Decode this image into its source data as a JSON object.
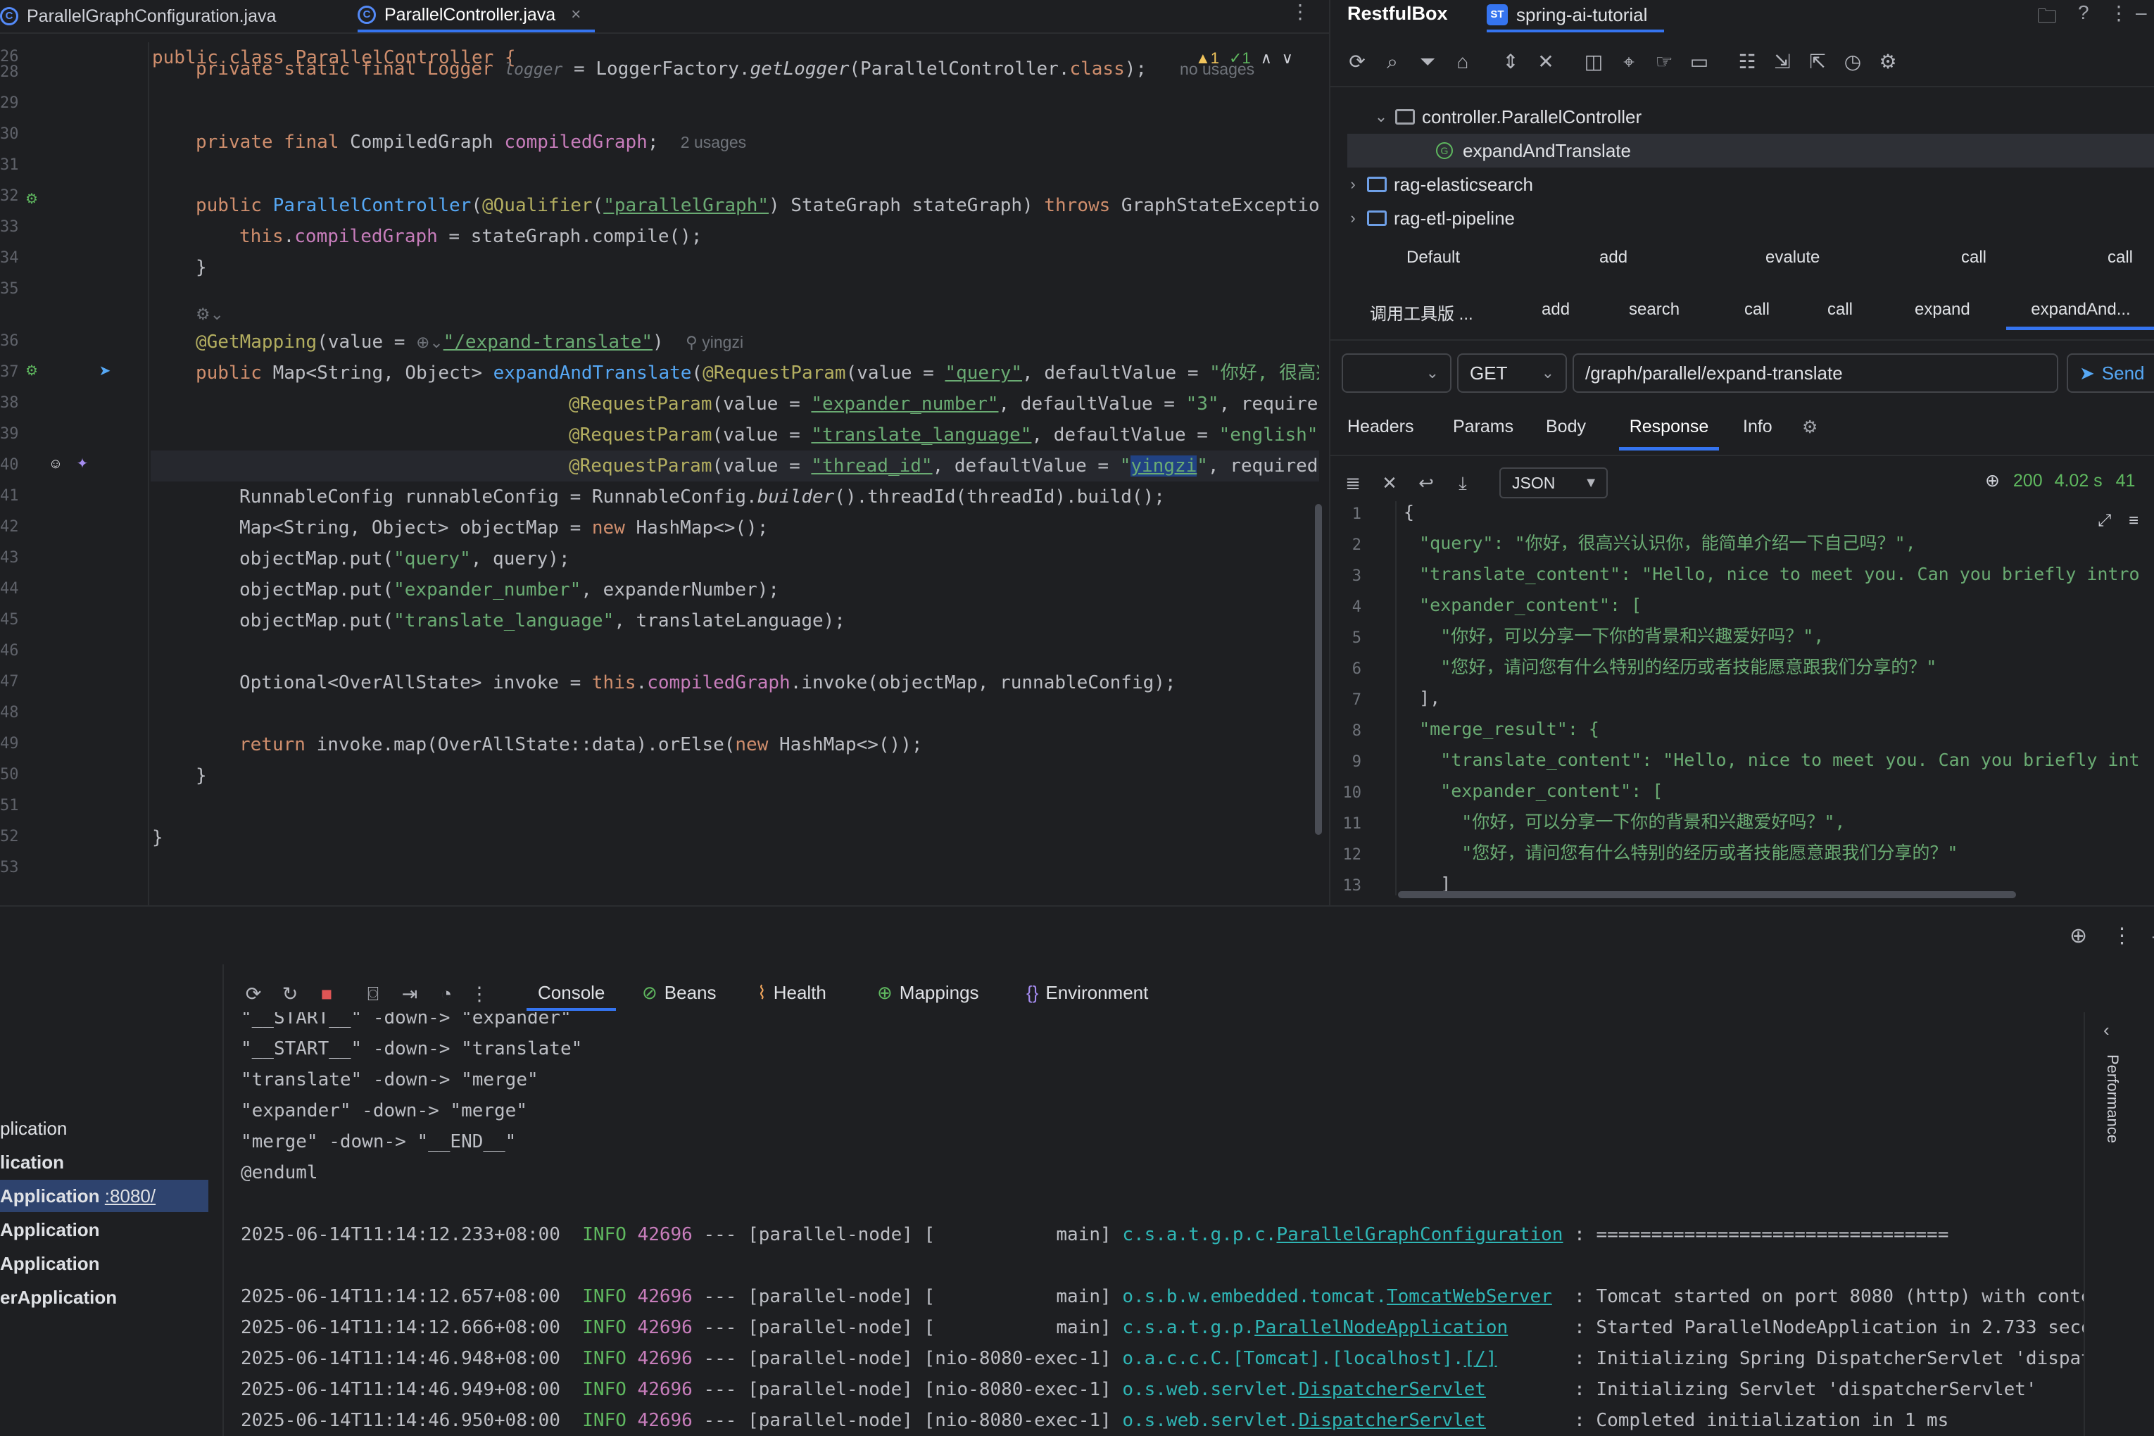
{
  "editor": {
    "tabs": [
      {
        "label": "ParallelGraphConfiguration.java",
        "active": false
      },
      {
        "label": "ParallelController.java",
        "active": true
      }
    ],
    "close_glyph": "×",
    "menu_glyph": "⋮",
    "inspection": {
      "warn": "▲1",
      "ok": "✓1",
      "up": "∧",
      "down": "∨"
    },
    "line_numbers": [
      "26",
      "28",
      "29",
      "30",
      "31",
      "32",
      "33",
      "34",
      "35",
      "36",
      "37",
      "38",
      "39",
      "40",
      "41",
      "42",
      "43",
      "44",
      "45",
      "46",
      "47",
      "48",
      "49",
      "50",
      "51",
      "52",
      "53"
    ],
    "code": {
      "l26": "public class ParallelController {",
      "l28_a": "private static final Logger ",
      "l28_b": "logger",
      "l28_c": " = LoggerFactory.",
      "l28_d": "getLogger",
      "l28_e": "(ParallelController.",
      "l28_f": "class",
      "l28_g": ");",
      "l28_usage": "no usages",
      "l30_a": "private final ",
      "l30_b": "CompiledGraph ",
      "l30_c": "compiledGraph",
      "l30_d": ";",
      "l30_usage": "2 usages",
      "l32_a": "public ",
      "l32_b": "ParallelController",
      "l32_c": "(",
      "l32_d": "@Qualifier",
      "l32_e": "(",
      "l32_f": "\"parallelGraph\"",
      "l32_g": ") StateGraph stateGraph) ",
      "l32_h": "throws",
      "l32_i": " GraphStateException",
      "l33_a": "this",
      "l33_b": ".",
      "l33_c": "compiledGraph",
      "l33_d": " = stateGraph.compile();",
      "l34": "}",
      "l36_hint": "⚙⌄",
      "l36_a": "@GetMapping",
      "l36_b": "(value = ",
      "l36_c": "⊕⌄",
      "l36_d": "\"/expand-translate\"",
      "l36_e": ")",
      "l36_author": "yingzi",
      "l37_a": "public ",
      "l37_b": "Map<String, Object> ",
      "l37_c": "expandAndTranslate",
      "l37_d": "(",
      "l37_e": "@RequestParam",
      "l37_f": "(value = ",
      "l37_g": "\"query\"",
      "l37_h": ", defaultValue = ",
      "l37_i": "\"你好, 很高兴",
      "l38_a": "@RequestParam",
      "l38_b": "(value = ",
      "l38_c": "\"expander_number\"",
      "l38_d": ", defaultValue = ",
      "l38_e": "\"3\"",
      "l38_f": ", required",
      "l39_a": "@RequestParam",
      "l39_b": "(value = ",
      "l39_c": "\"translate_language\"",
      "l39_d": ", defaultValue = ",
      "l39_e": "\"english\"",
      "l39_f": ",",
      "l40_a": "@RequestParam",
      "l40_b": "(value = ",
      "l40_c": "\"thread_id\"",
      "l40_d": ", defaultValue = ",
      "l40_e": "\"",
      "l40_f": "yingzi",
      "l40_g": "\"",
      "l40_h": ", required",
      "l41_a": "RunnableConfig runnableConfig = RunnableConfig.",
      "l41_b": "builder",
      "l41_c": "().threadId(threadId).build();",
      "l42_a": "Map<String, Object> objectMap = ",
      "l42_b": "new",
      "l42_c": " HashMap<>();",
      "l43_a": "objectMap.put(",
      "l43_b": "\"query\"",
      "l43_c": ", query);",
      "l44_a": "objectMap.put(",
      "l44_b": "\"expander_number\"",
      "l44_c": ", expanderNumber);",
      "l45_a": "objectMap.put(",
      "l45_b": "\"translate_language\"",
      "l45_c": ", translateLanguage);",
      "l47_a": "Optional<OverAllState> invoke = ",
      "l47_b": "this",
      "l47_c": ".",
      "l47_d": "compiledGraph",
      "l47_e": ".invoke(objectMap, runnableConfig);",
      "l49_a": "return",
      "l49_b": " invoke.map(OverAllState::data).orElse(",
      "l49_c": "new",
      "l49_d": " HashMap<>());",
      "l50": "}",
      "l52": "}"
    }
  },
  "restfulbox": {
    "title": "RestfulBox",
    "project_badge": "ST",
    "project_tab": "spring-ai-tutorial",
    "header_icons": [
      "folder-icon",
      "help-icon",
      "more-icon"
    ],
    "tree": [
      {
        "label": "controller.ParallelController",
        "expanded": true
      },
      {
        "label": "expandAndTranslate",
        "selected": true
      },
      {
        "label": "rag-elasticsearch",
        "expanded": false
      },
      {
        "label": "rag-etl-pipeline",
        "expanded": false
      }
    ],
    "tree_badge": "G",
    "request_tabs_row1": [
      "Default",
      "add",
      "evalute",
      "call",
      "call"
    ],
    "request_tabs_row2": [
      "调用工具版 ...",
      "add",
      "search",
      "call",
      "call",
      "expand",
      "expandAnd..."
    ],
    "env_select": "",
    "method": "GET",
    "url": "/graph/parallel/expand-translate",
    "send_label": "Send",
    "subtabs": [
      "Headers",
      "Params",
      "Body",
      "Response",
      "Info"
    ],
    "active_subtab": "Response",
    "format": "JSON",
    "status_code": "200",
    "elapsed": "4.02 s",
    "size_fragment": "41",
    "response_line_numbers": [
      "1",
      "2",
      "3",
      "4",
      "5",
      "6",
      "7",
      "8",
      "9",
      "10",
      "11",
      "12",
      "13"
    ],
    "response_lines": [
      "{",
      "  \"query\": \"你好，很高兴认识你，能简单介绍一下自己吗？\",",
      "  \"translate_content\": \"Hello, nice to meet you. Can you briefly intro",
      "  \"expander_content\": [",
      "    \"你好，可以分享一下你的背景和兴趣爱好吗？\",",
      "    \"您好，请问您有什么特别的经历或者技能愿意跟我们分享的？\"",
      "  ],",
      "  \"merge_result\": {",
      "    \"translate_content\": \"Hello, nice to meet you. Can you briefly int",
      "    \"expander_content\": [",
      "      \"你好，可以分享一下你的背景和兴趣爱好吗？\",",
      "      \"您好，请问您有什么特别的经历或者技能愿意跟我们分享的？\"",
      "    ]"
    ]
  },
  "services": {
    "run_list": [
      {
        "label": "plication"
      },
      {
        "label": "lication"
      },
      {
        "label": "Application",
        "port": ":8080/",
        "selected": true
      },
      {
        "label": "Application"
      },
      {
        "label": "Application"
      },
      {
        "label": "erApplication"
      }
    ],
    "tabs": [
      "Console",
      "Beans",
      "Health",
      "Mappings",
      "Environment"
    ],
    "active_tab": "Console",
    "performance_label": "Performance",
    "console_plain": [
      "\"__START__\" -down-> \"expander\"",
      "\"__START__\" -down-> \"translate\"",
      "\"translate\" -down-> \"merge\"",
      "\"expander\" -down-> \"merge\"",
      "\"merge\" -down-> \"__END__\"",
      "@enduml"
    ],
    "logs": [
      {
        "ts": "2025-06-14T11:14:12.233+08:00",
        "level": "INFO",
        "pid": "42696",
        "mid": " --- [parallel-node] [           main] ",
        "logger_pkg": "c.s.a.t.g.p.c.",
        "logger_cls": "ParallelGraphConfiguration",
        "pad": " : ",
        "msg": "================================"
      },
      {
        "ts": "2025-06-14T11:14:12.657+08:00",
        "level": "INFO",
        "pid": "42696",
        "mid": " --- [parallel-node] [           main] ",
        "logger_pkg": "o.s.b.w.embedded.tomcat.",
        "logger_cls": "TomcatWebServer",
        "pad": "  : ",
        "msg": "Tomcat started on port 8080 (http) with conte"
      },
      {
        "ts": "2025-06-14T11:14:12.666+08:00",
        "level": "INFO",
        "pid": "42696",
        "mid": " --- [parallel-node] [           main] ",
        "logger_pkg": "c.s.a.t.g.p.",
        "logger_cls": "ParallelNodeApplication",
        "pad": "      : ",
        "msg": "Started ParallelNodeApplication in 2.733 seco"
      },
      {
        "ts": "2025-06-14T11:14:46.948+08:00",
        "level": "INFO",
        "pid": "42696",
        "mid": " --- [parallel-node] [nio-8080-exec-1] ",
        "logger_pkg": "o.a.c.c.C.[Tomcat].[localhost].",
        "logger_cls": "[/]",
        "pad": "       : ",
        "msg": "Initializing Spring DispatcherServlet 'dispat"
      },
      {
        "ts": "2025-06-14T11:14:46.949+08:00",
        "level": "INFO",
        "pid": "42696",
        "mid": " --- [parallel-node] [nio-8080-exec-1] ",
        "logger_pkg": "o.s.web.servlet.",
        "logger_cls": "DispatcherServlet",
        "pad": "        : ",
        "msg": "Initializing Servlet 'dispatcherServlet'"
      },
      {
        "ts": "2025-06-14T11:14:46.950+08:00",
        "level": "INFO",
        "pid": "42696",
        "mid": " --- [parallel-node] [nio-8080-exec-1] ",
        "logger_pkg": "o.s.web.servlet.",
        "logger_cls": "DispatcherServlet",
        "pad": "        : ",
        "msg": "Completed initialization in 1 ms"
      }
    ]
  }
}
